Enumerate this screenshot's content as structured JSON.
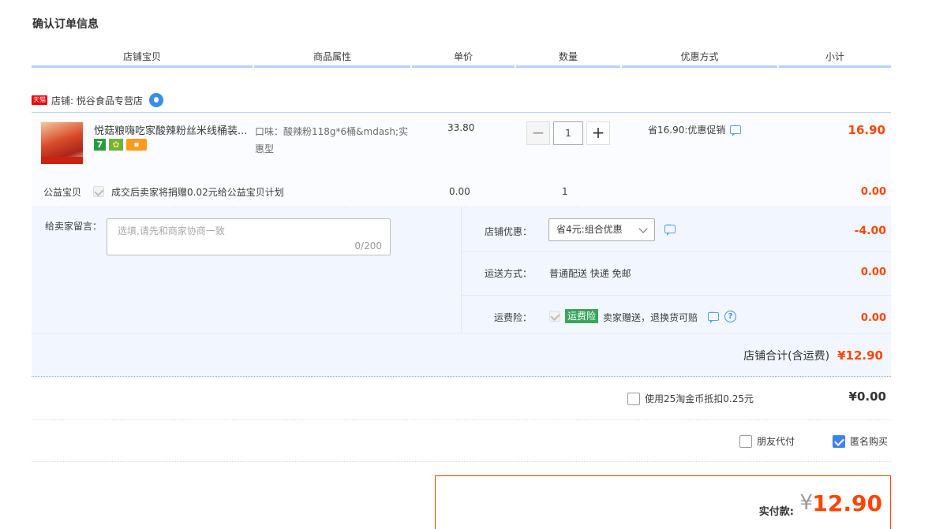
{
  "page_title": "确认订单信息",
  "columns": [
    "店铺宝贝",
    "商品属性",
    "单价",
    "数量",
    "优惠方式",
    "小计"
  ],
  "shop": {
    "badge": "天猫",
    "label": "店铺: 悦谷食品专营店"
  },
  "item": {
    "title": "悦菇粮嗨吃家酸辣粉丝米线桶装...",
    "badges": {
      "seven": "7",
      "sun": "✿",
      "card": "▪"
    },
    "attribute": "口味：酸辣粉118g*6桶&mdash;实惠型",
    "price": "33.80",
    "quantity": "1",
    "minus": "−",
    "plus": "+",
    "promo": "省16.90:优惠促销",
    "subtotal": "16.90"
  },
  "charity": {
    "label": "公益宝贝",
    "text": "成交后卖家将捐赠0.02元给公益宝贝计划",
    "price": "0.00",
    "qty": "1",
    "subtotal": "0.00"
  },
  "memo": {
    "label": "给卖家留言：",
    "placeholder": "选填,请先和商家协商一致",
    "count": "0/200"
  },
  "discount": {
    "label": "店铺优惠：",
    "selected": "省4元:组合优惠",
    "value": "-4.00"
  },
  "shipping": {
    "label": "运送方式：",
    "text": "普通配送 快递 免邮",
    "value": "0.00"
  },
  "insurance": {
    "label": "运费险：",
    "tag": "运费险",
    "text": "卖家赠送，退换货可赔",
    "help": "?",
    "value": "0.00"
  },
  "store_total": {
    "label": "店铺合计(含运费)",
    "value": "¥12.90"
  },
  "coin": {
    "label": "使用25淘金币抵扣0.25元",
    "value": "¥0.00"
  },
  "friend_pay": "朋友代付",
  "anonymous": "匿名购买",
  "payment": {
    "label": "实付款:",
    "yen": "¥",
    "amount": "12.90"
  },
  "colors": {
    "accent": "#ff4400",
    "header_line": "#b2d1ff",
    "checkbox": "#3e82f7"
  }
}
